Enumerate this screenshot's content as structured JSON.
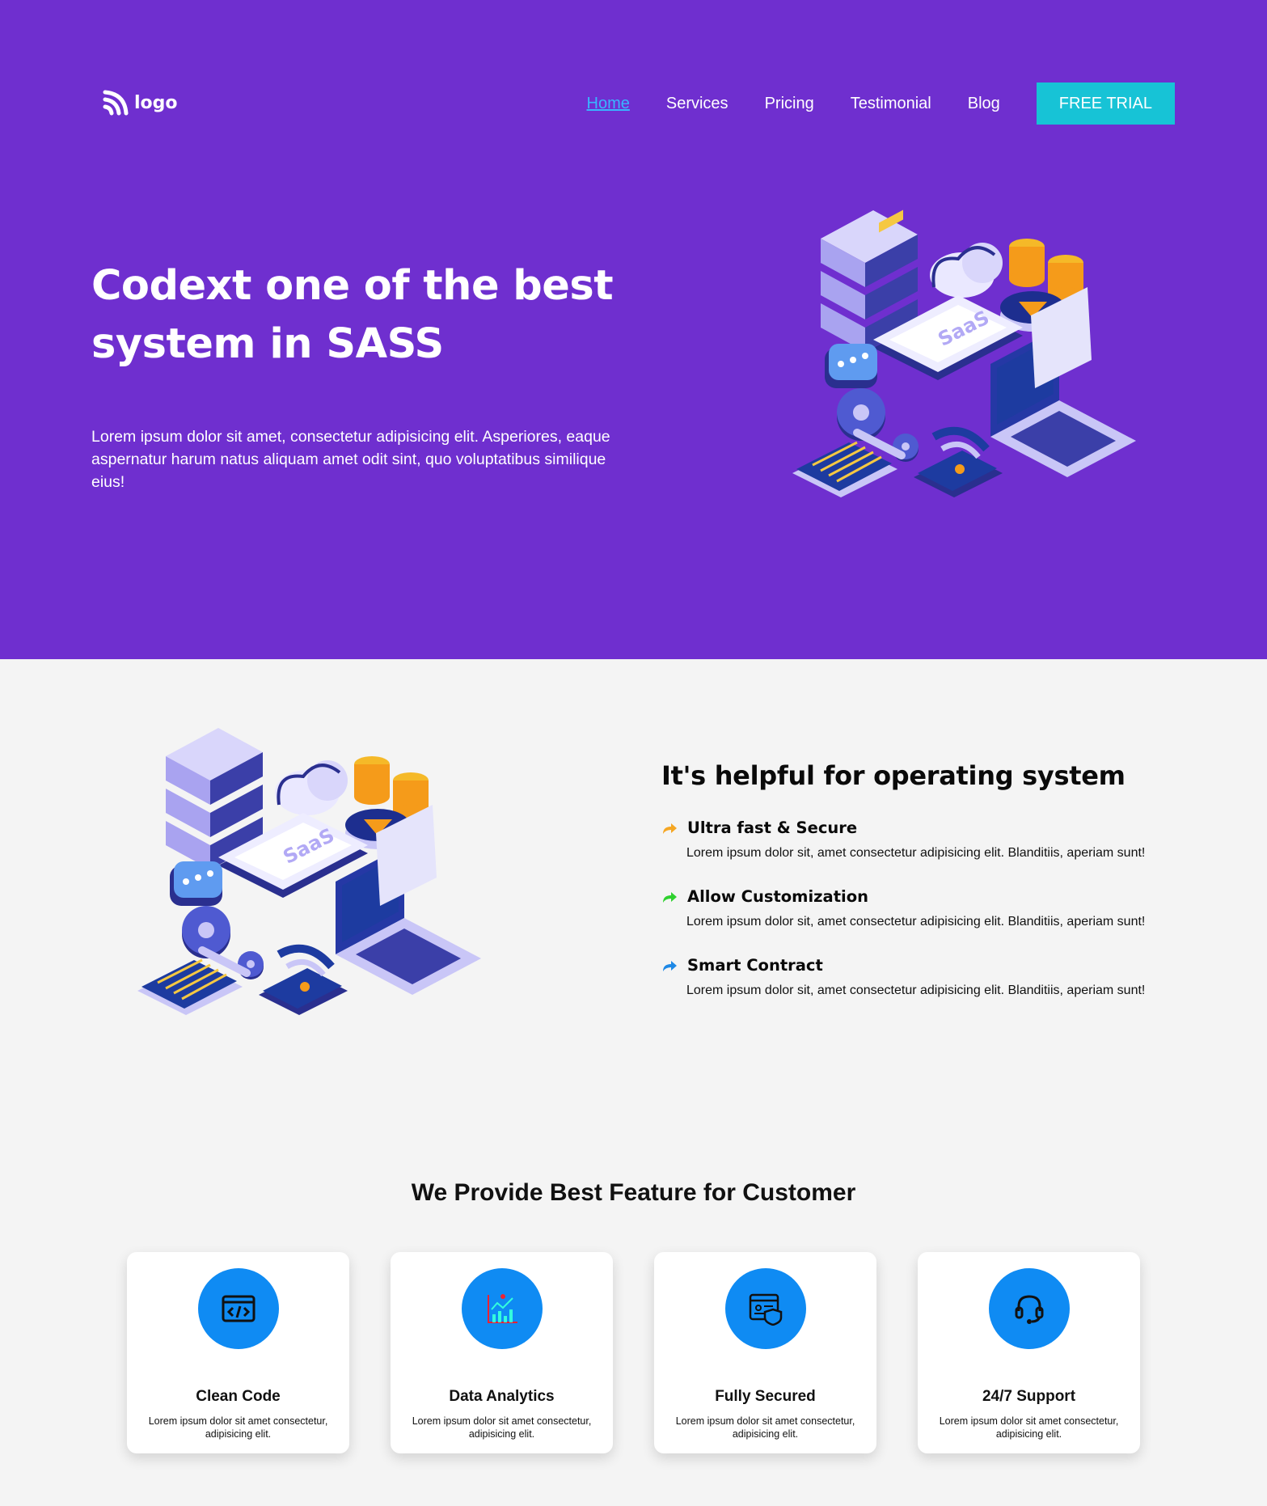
{
  "brand": {
    "logo_text": "logo"
  },
  "nav": {
    "items": [
      {
        "label": "Home",
        "active": true
      },
      {
        "label": "Services"
      },
      {
        "label": "Pricing"
      },
      {
        "label": "Testimonial"
      },
      {
        "label": "Blog"
      }
    ],
    "cta_label": "FREE TRIAL"
  },
  "hero": {
    "title_line1": "Codext one of the best",
    "title_line2": "system in SASS",
    "text": "Lorem ipsum dolor sit amet, consectetur adipisicing elit. Asperiores, eaque aspernatur harum natus aliquam amet odit sint, quo voluptatibus similique eius!",
    "illustration_label": "SaaS"
  },
  "features_section": {
    "title": "It's helpful for operating system",
    "items": [
      {
        "name": "Ultra fast & Secure",
        "desc": "Lorem ipsum dolor sit, amet consectetur adipisicing elit. Blanditiis, aperiam sunt!",
        "arrow_color": "#f5a623"
      },
      {
        "name": "Allow Customization",
        "desc": "Lorem ipsum dolor sit, amet consectetur adipisicing elit. Blanditiis, aperiam sunt!",
        "arrow_color": "#2fd12f"
      },
      {
        "name": "Smart Contract",
        "desc": "Lorem ipsum dolor sit, amet consectetur adipisicing elit. Blanditiis, aperiam sunt!",
        "arrow_color": "#1e88e5"
      }
    ]
  },
  "cards_section": {
    "title": "We Provide Best Feature for Customer",
    "cards": [
      {
        "name": "Clean Code",
        "text": "Lorem ipsum dolor sit amet consectetur, adipisicing elit.",
        "icon": "code-window-icon"
      },
      {
        "name": "Data Analytics",
        "text": "Lorem ipsum dolor sit amet consectetur, adipisicing elit.",
        "icon": "analytics-chart-icon"
      },
      {
        "name": "Fully Secured",
        "text": "Lorem ipsum dolor sit amet consectetur, adipisicing elit.",
        "icon": "secure-shield-icon"
      },
      {
        "name": "24/7 Support",
        "text": "Lorem ipsum dolor sit amet consectetur, adipisicing elit.",
        "icon": "headset-icon"
      }
    ]
  },
  "colors": {
    "hero_bg": "#6f2fcf",
    "accent": "#17c3d6",
    "link_active": "#38b6ff",
    "card_icon_bg": "#0f8bf3",
    "page_bg": "#f4f4f4"
  }
}
